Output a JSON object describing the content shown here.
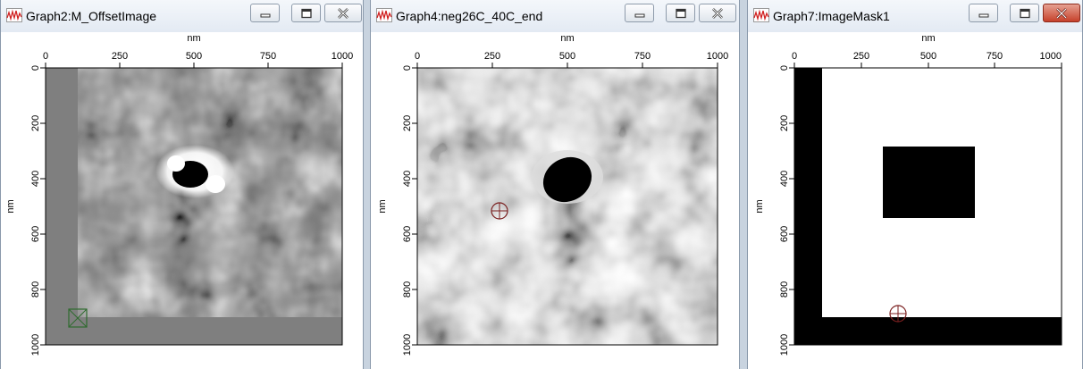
{
  "windows": [
    {
      "id": "w1",
      "title": "Graph2:M_OffsetImage",
      "xlabel": "nm",
      "ylabel": "nm",
      "xticks": [
        "0",
        "250",
        "500",
        "750",
        "1000"
      ],
      "yticks": [
        "0",
        "200",
        "400",
        "600",
        "800",
        "1000"
      ],
      "active": false
    },
    {
      "id": "w2",
      "title": "Graph4:neg26C_40C_end",
      "xlabel": "nm",
      "ylabel": "nm",
      "xticks": [
        "0",
        "250",
        "500",
        "750",
        "1000"
      ],
      "yticks": [
        "0",
        "200",
        "400",
        "600",
        "800",
        "1000"
      ],
      "active": false
    },
    {
      "id": "w3",
      "title": "Graph7:ImageMask1",
      "xlabel": "nm",
      "ylabel": "nm",
      "xticks": [
        "0",
        "250",
        "500",
        "750",
        "1000"
      ],
      "yticks": [
        "0",
        "200",
        "400",
        "600",
        "800",
        "1000"
      ],
      "active": true
    }
  ],
  "colors": {
    "desktop": "#c8d3df",
    "offset_fill": "#7f7f7f",
    "mask_black": "#000000",
    "mask_white": "#ffffff",
    "cursor_green": "#2e6b2e",
    "cursor_red": "#7a1f1f",
    "close_active": "#c6412b"
  },
  "icons": {
    "window": "graph-window-icon",
    "minimize": "minimize-icon",
    "maximize": "maximize-icon",
    "close": "close-icon",
    "cursor_box": "square-cursor-icon",
    "cursor_cross": "crosshair-cursor-icon"
  }
}
